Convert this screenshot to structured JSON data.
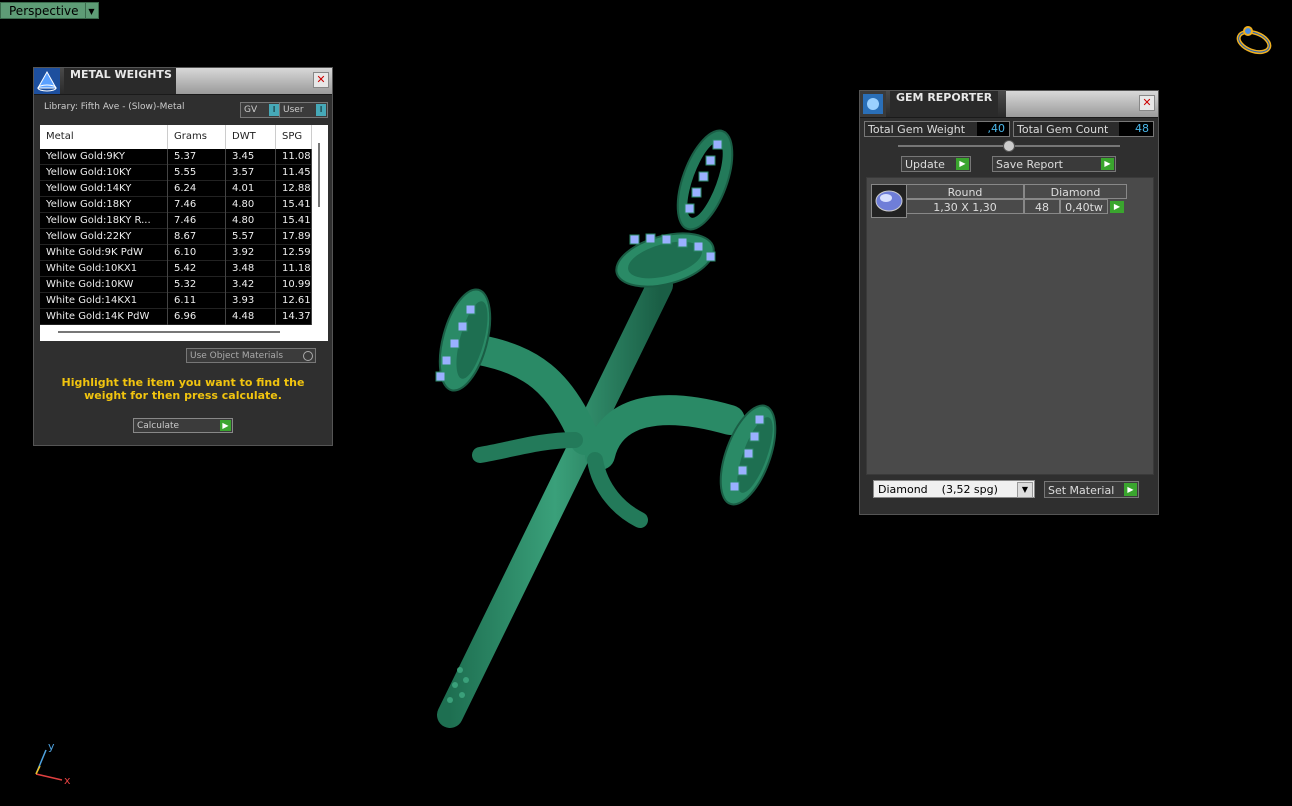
{
  "viewport": {
    "label": "Perspective",
    "dropdown_glyph": "▼"
  },
  "metal_weights": {
    "title": "METAL WEIGHTS",
    "library": "Library: Fifth Ave - (Slow)-Metal",
    "gv_label": "GV",
    "user_label": "User",
    "columns": [
      "Metal",
      "Grams",
      "DWT",
      "SPG"
    ],
    "rows": [
      [
        "Yellow Gold:9KY",
        "5.37",
        "3.45",
        "11.08"
      ],
      [
        "Yellow Gold:10KY",
        "5.55",
        "3.57",
        "11.45"
      ],
      [
        "Yellow Gold:14KY",
        "6.24",
        "4.01",
        "12.88"
      ],
      [
        "Yellow Gold:18KY",
        "7.46",
        "4.80",
        "15.41"
      ],
      [
        "Yellow Gold:18KY R...",
        "7.46",
        "4.80",
        "15.41"
      ],
      [
        "Yellow Gold:22KY",
        "8.67",
        "5.57",
        "17.89"
      ],
      [
        "White Gold:9K PdW",
        "6.10",
        "3.92",
        "12.59"
      ],
      [
        "White Gold:10KX1",
        "5.42",
        "3.48",
        "11.18"
      ],
      [
        "White Gold:10KW",
        "5.32",
        "3.42",
        "10.99"
      ],
      [
        "White Gold:14KX1",
        "6.11",
        "3.93",
        "12.61"
      ],
      [
        "White Gold:14K PdW",
        "6.96",
        "4.48",
        "14.37"
      ]
    ],
    "use_object_materials": "Use Object Materials",
    "hint": "Highlight the item you want to find the weight for then press calculate.",
    "calculate": "Calculate"
  },
  "gem_reporter": {
    "title": "GEM REPORTER",
    "total_weight_label": "Total Gem Weight",
    "total_weight_value": ",40",
    "total_count_label": "Total Gem Count",
    "total_count_value": "48",
    "update": "Update",
    "save_report": "Save Report",
    "gem": {
      "shape": "Round",
      "material": "Diamond",
      "size": "1,30 X 1,30",
      "count": "48",
      "weight": "0,40tw"
    },
    "material_select": "Diamond    (3,52 spg)",
    "set_material": "Set Material"
  },
  "axis": {
    "y": "y",
    "x": "x"
  },
  "colors": {
    "model": "#2a8a66",
    "gem": "#9ab0ff",
    "accent_green": "#3aa52e",
    "hint_yellow": "#f1c40f"
  }
}
